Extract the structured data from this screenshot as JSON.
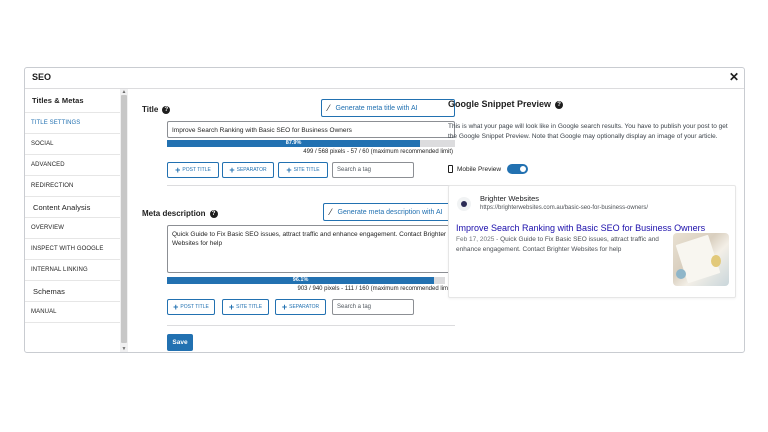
{
  "modal": {
    "title": "SEO",
    "close": "✕"
  },
  "sidebar": {
    "items": [
      {
        "label": "Titles & Metas"
      },
      {
        "label": "TITLE SETTINGS"
      },
      {
        "label": "SOCIAL"
      },
      {
        "label": "ADVANCED"
      },
      {
        "label": "REDIRECTION"
      },
      {
        "label": "Content Analysis"
      },
      {
        "label": "OVERVIEW"
      },
      {
        "label": "INSPECT WITH GOOGLE"
      },
      {
        "label": "INTERNAL LINKING"
      },
      {
        "label": "Schemas"
      },
      {
        "label": "MANUAL"
      }
    ]
  },
  "title_field": {
    "label": "Title",
    "help": "?",
    "generate_label": "Generate meta title with AI",
    "value": "Improve Search Ranking with Basic SEO for Business Owners",
    "progress": 87.9,
    "progress_label": "87.9%",
    "count": "499 / 568 pixels - 57 / 60 (maximum recommended limit)",
    "tags": [
      "POST TITLE",
      "SEPARATOR",
      "SITE TITLE"
    ],
    "search_placeholder": "Search a tag"
  },
  "meta_field": {
    "label": "Meta description",
    "help": "?",
    "generate_label": "Generate meta description with AI",
    "value": "Quick Guide to Fix Basic SEO issues, attract traffic and enhance engagement. Contact Brighter Websites for help",
    "progress": 96.1,
    "progress_label": "96.1%",
    "count": "903 / 940 pixels - 111 / 160 (maximum recommended limit)",
    "tags": [
      "POST TITLE",
      "SITE TITLE",
      "SEPARATOR"
    ],
    "search_placeholder": "Search a tag"
  },
  "save_label": "Save",
  "preview": {
    "title": "Google Snippet Preview",
    "help": "?",
    "description": "This is what your page will look like in Google search results. You have to publish your post to get the Google Snippet Preview. Note that Google may optionally display an image of your article.",
    "mobile_label": "Mobile Preview",
    "mobile_on": true,
    "site_name": "Brighter Websites",
    "site_url": "https://brighterwebsites.com.au/basic-seo-for-business-owners/",
    "snippet_title": "Improve Search Ranking with Basic SEO for Business Owners",
    "snippet_date": "Feb 17, 2025 -",
    "snippet_desc": "Quick Guide to Fix Basic SEO issues, attract traffic and enhance engagement. Contact Brighter Websites for help"
  },
  "colors": {
    "accent": "#2271b1",
    "link": "#1a0dab"
  }
}
